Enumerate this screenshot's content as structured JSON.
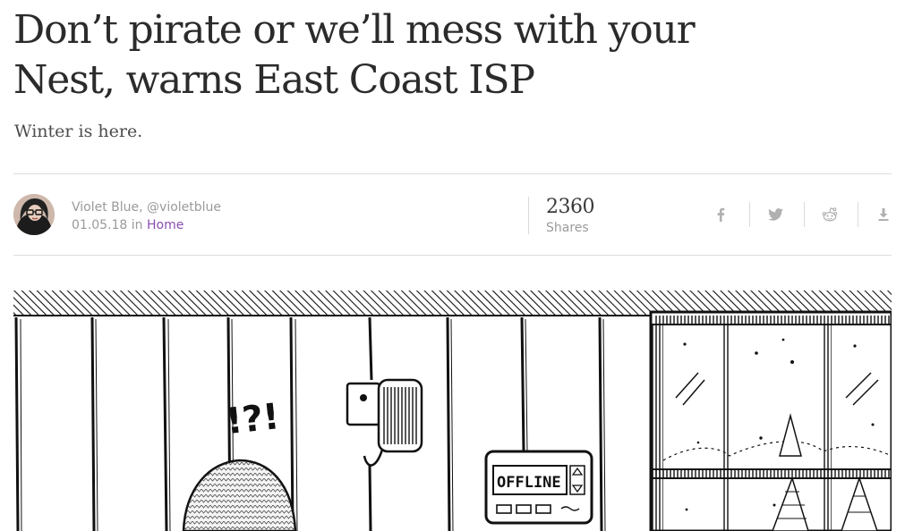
{
  "article": {
    "headline_line1": "Don’t pirate or we’ll mess with your",
    "headline_line2": "Nest, warns East Coast ISP",
    "subtitle": "Winter is here."
  },
  "author": {
    "byline": "Violet Blue, @violetblue",
    "date": "01.05.18",
    "in_label": "in",
    "category": "Home"
  },
  "shares": {
    "count": "2360",
    "label": "Shares"
  },
  "social": [
    {
      "name": "facebook",
      "icon": "facebook-icon"
    },
    {
      "name": "twitter",
      "icon": "twitter-icon"
    },
    {
      "name": "reddit",
      "icon": "reddit-icon"
    },
    {
      "name": "download",
      "icon": "download-icon"
    }
  ],
  "illustration": {
    "bubble_text": "!?!",
    "thermostat_text": "OFFLINE"
  },
  "colors": {
    "link": "#8a4fb0",
    "rule": "#dcdcdc",
    "icon": "#b0b0b0"
  }
}
